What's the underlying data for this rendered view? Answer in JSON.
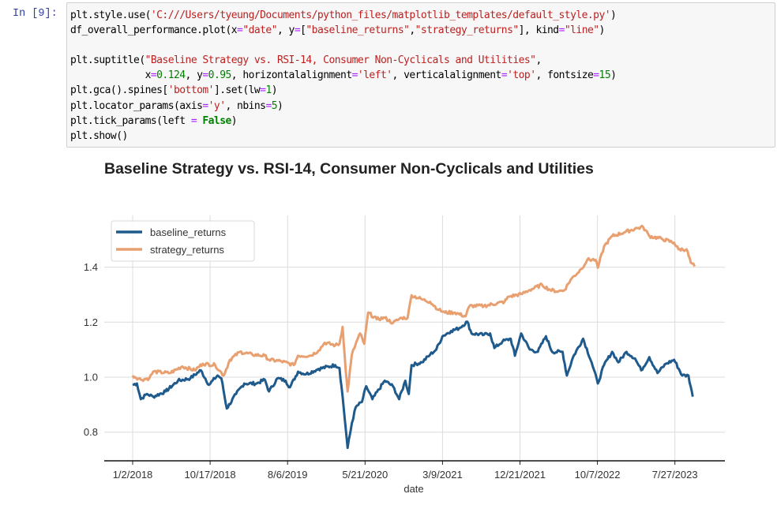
{
  "cell": {
    "prompt": "In [9]:",
    "code_lines": [
      [
        [
          "plt.style.use(",
          "p"
        ],
        [
          "'C:///Users/tyeung/Documents/python_files/matplotlib_templates/default_style.py'",
          "str"
        ],
        [
          ")",
          "p"
        ]
      ],
      [
        [
          "df_overall_performance.plot(x",
          "p"
        ],
        [
          "=",
          "op"
        ],
        [
          "\"date\"",
          "str"
        ],
        [
          ", y",
          "p"
        ],
        [
          "=",
          "op"
        ],
        [
          "[",
          "p"
        ],
        [
          "\"baseline_returns\"",
          "str"
        ],
        [
          ",",
          "p"
        ],
        [
          "\"strategy_returns\"",
          "str"
        ],
        [
          "], kind",
          "p"
        ],
        [
          "=",
          "op"
        ],
        [
          "\"line\"",
          "str"
        ],
        [
          ")",
          "p"
        ]
      ],
      [],
      [
        [
          "plt.suptitle(",
          "p"
        ],
        [
          "\"Baseline Strategy vs. RSI-14, Consumer Non-Cyclicals and Utilities\"",
          "str"
        ],
        [
          ",",
          "p"
        ]
      ],
      [
        [
          "             x",
          "p"
        ],
        [
          "=",
          "op"
        ],
        [
          "0.124",
          "num"
        ],
        [
          ", y",
          "p"
        ],
        [
          "=",
          "op"
        ],
        [
          "0.95",
          "num"
        ],
        [
          ", horizontalalignment",
          "p"
        ],
        [
          "=",
          "op"
        ],
        [
          "'left'",
          "str"
        ],
        [
          ", verticalalignment",
          "p"
        ],
        [
          "=",
          "op"
        ],
        [
          "'top'",
          "str"
        ],
        [
          ", fontsize",
          "p"
        ],
        [
          "=",
          "op"
        ],
        [
          "15",
          "num"
        ],
        [
          ")",
          "p"
        ]
      ],
      [
        [
          "plt.gca().spines[",
          "p"
        ],
        [
          "'bottom'",
          "str"
        ],
        [
          "].set(lw",
          "p"
        ],
        [
          "=",
          "op"
        ],
        [
          "1",
          "num"
        ],
        [
          ")",
          "p"
        ]
      ],
      [
        [
          "plt.locator_params(axis",
          "p"
        ],
        [
          "=",
          "op"
        ],
        [
          "'y'",
          "str"
        ],
        [
          ", nbins",
          "p"
        ],
        [
          "=",
          "op"
        ],
        [
          "5",
          "num"
        ],
        [
          ")",
          "p"
        ]
      ],
      [
        [
          "plt.tick_params(left ",
          "p"
        ],
        [
          "=",
          "op"
        ],
        [
          " ",
          "p"
        ],
        [
          "False",
          "kw"
        ],
        [
          ")",
          "p"
        ]
      ],
      [
        [
          "plt.show()",
          "p"
        ]
      ]
    ]
  },
  "chart_data": {
    "type": "line",
    "title": "Baseline Strategy vs. RSI-14, Consumer Non-Cyclicals and Utilities",
    "xlabel": "date",
    "ylabel": "",
    "x_unit": "trading-day index",
    "x_ticks": [
      {
        "day": 0,
        "label": "1/2/2018"
      },
      {
        "day": 200,
        "label": "10/17/2018"
      },
      {
        "day": 400,
        "label": "8/6/2019"
      },
      {
        "day": 600,
        "label": "5/21/2020"
      },
      {
        "day": 800,
        "label": "3/9/2021"
      },
      {
        "day": 1000,
        "label": "12/21/2021"
      },
      {
        "day": 1200,
        "label": "10/7/2022"
      },
      {
        "day": 1400,
        "label": "7/27/2023"
      }
    ],
    "y_ticks": [
      0.8,
      1.0,
      1.2,
      1.4
    ],
    "y_tick_labels": [
      "0.8",
      "1.0",
      "1.2",
      "1.4"
    ],
    "xlim": [
      -73,
      1530
    ],
    "ylim": [
      0.696,
      1.59
    ],
    "grid": true,
    "legend_position": "upper-left",
    "series": [
      {
        "name": "baseline_returns",
        "color": "#1f5a8c",
        "x": [
          0,
          11,
          21,
          37,
          53,
          85,
          117,
          149,
          176,
          197,
          219,
          229,
          243,
          267,
          288,
          320,
          341,
          352,
          374,
          395,
          406,
          427,
          448,
          480,
          523,
          534,
          542,
          550,
          555,
          566,
          576,
          592,
          603,
          619,
          651,
          672,
          688,
          704,
          713,
          720,
          747,
          768,
          784,
          800,
          822,
          843,
          864,
          875,
          907,
          923,
          934,
          955,
          976,
          987,
          1003,
          1025,
          1046,
          1067,
          1083,
          1110,
          1121,
          1137,
          1163,
          1185,
          1201,
          1217,
          1238,
          1254,
          1275,
          1297,
          1313,
          1334,
          1355,
          1377,
          1398,
          1419,
          1435,
          1446
        ],
        "values": [
          0.972,
          0.977,
          0.92,
          0.939,
          0.929,
          0.948,
          0.987,
          0.996,
          1.025,
          0.972,
          1.006,
          0.996,
          0.886,
          0.939,
          0.977,
          0.977,
          0.991,
          0.948,
          0.996,
          0.987,
          0.963,
          1.02,
          1.011,
          1.03,
          1.044,
          1.034,
          0.929,
          0.814,
          0.743,
          0.833,
          0.891,
          0.91,
          0.967,
          0.92,
          0.987,
          0.967,
          0.92,
          0.987,
          0.939,
          1.044,
          1.054,
          1.082,
          1.101,
          1.149,
          1.168,
          1.178,
          1.202,
          1.159,
          1.154,
          1.159,
          1.106,
          1.13,
          1.14,
          1.078,
          1.159,
          1.101,
          1.092,
          1.149,
          1.092,
          1.092,
          1.006,
          1.073,
          1.14,
          1.054,
          0.977,
          1.044,
          1.092,
          1.054,
          1.092,
          1.068,
          1.025,
          1.073,
          1.015,
          1.049,
          1.063,
          1.006,
          1.006,
          0.929
        ]
      },
      {
        "name": "strategy_returns",
        "color": "#e8a070",
        "x": [
          0,
          21,
          43,
          53,
          96,
          128,
          160,
          181,
          213,
          235,
          251,
          277,
          309,
          341,
          352,
          384,
          416,
          427,
          459,
          480,
          496,
          523,
          534,
          542,
          550,
          555,
          566,
          576,
          587,
          598,
          608,
          630,
          651,
          672,
          694,
          710,
          720,
          747,
          768,
          790,
          806,
          832,
          859,
          870,
          907,
          960,
          971,
          1003,
          1025,
          1057,
          1078,
          1099,
          1115,
          1131,
          1158,
          1174,
          1195,
          1201,
          1217,
          1238,
          1270,
          1302,
          1318,
          1334,
          1366,
          1398,
          1409,
          1430,
          1441,
          1451
        ],
        "values": [
          1.006,
          0.991,
          0.996,
          1.02,
          1.015,
          1.039,
          1.025,
          1.049,
          1.044,
          1.006,
          1.063,
          1.092,
          1.082,
          1.078,
          1.063,
          1.058,
          1.044,
          1.078,
          1.078,
          1.097,
          1.125,
          1.116,
          1.121,
          1.183,
          1.025,
          0.948,
          1.082,
          1.121,
          1.159,
          1.121,
          1.235,
          1.211,
          1.216,
          1.197,
          1.216,
          1.216,
          1.298,
          1.283,
          1.274,
          1.245,
          1.235,
          1.235,
          1.221,
          1.259,
          1.259,
          1.274,
          1.293,
          1.302,
          1.317,
          1.336,
          1.317,
          1.312,
          1.317,
          1.355,
          1.393,
          1.427,
          1.427,
          1.398,
          1.475,
          1.513,
          1.527,
          1.542,
          1.546,
          1.513,
          1.503,
          1.489,
          1.465,
          1.465,
          1.417,
          1.403
        ]
      }
    ]
  }
}
